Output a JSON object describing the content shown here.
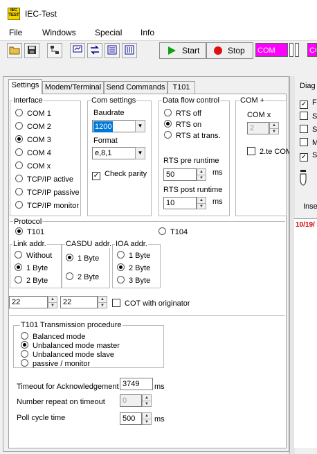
{
  "window": {
    "title": "IEC-Test",
    "app_icon_text": "IEC TEST"
  },
  "menu": [
    "File",
    "Windows",
    "Special",
    "Info"
  ],
  "toolbar": {
    "start_label": "Start",
    "stop_label": "Stop",
    "com_indicator_1": "COM",
    "com_indicator_2": "CO",
    "icons": [
      "open-icon",
      "save-icon",
      "connect-icon",
      "monitor-icon",
      "swap-icon",
      "list-icon",
      "settings-icon"
    ]
  },
  "tabs": [
    "Settings",
    "Modem/Terminal",
    "Send Commands",
    "T101"
  ],
  "interface": {
    "title": "Interface",
    "options": [
      "COM 1",
      "COM 2",
      "COM 3",
      "COM 4",
      "COM x",
      "TCP/IP active",
      "TCP/IP passive",
      "TCP/IP monitor"
    ],
    "selected": "COM 3"
  },
  "com_settings": {
    "title": "Com settings",
    "baudrate_label": "Baudrate",
    "baudrate_value": "1200",
    "format_label": "Format",
    "format_value": "e,8,1",
    "check_parity_label": "Check parity",
    "check_parity": true
  },
  "data_flow": {
    "title": "Data flow control",
    "options": [
      "RTS off",
      "RTS on",
      "RTS at trans."
    ],
    "selected": "RTS on",
    "pre_label": "RTS pre runtime",
    "pre_value": "50",
    "post_label": "RTS post runtime",
    "post_value": "10",
    "unit": "ms"
  },
  "com_plus": {
    "title": "COM +",
    "comx_label": "COM x",
    "comx_value": "2",
    "second_com_label": "2.te COM"
  },
  "protocol": {
    "title": "Protocol",
    "options": [
      "T101",
      "T104"
    ],
    "selected": "T101"
  },
  "link_addr": {
    "title": "Link addr.",
    "options": [
      "Without",
      "1 Byte",
      "2 Byte"
    ],
    "selected": "1 Byte"
  },
  "casdu_addr": {
    "title": "CASDU addr.",
    "options": [
      "1 Byte",
      "2 Byte"
    ],
    "selected": "1 Byte"
  },
  "ioa_addr": {
    "title": "IOA addr.",
    "options": [
      "1 Byte",
      "2 Byte",
      "3 Byte"
    ],
    "selected": "2 Byte"
  },
  "address_values": {
    "first": "22",
    "second": "22",
    "cot_label": "COT with originator"
  },
  "transmission": {
    "title": "T101 Transmission procedure",
    "options": [
      "Balanced mode",
      "Unbalanced mode master",
      "Unbalanced mode slave",
      "passive / monitor"
    ],
    "selected": "Unbalanced mode master"
  },
  "timing": {
    "timeout_label": "Timeout for Acknowledgement",
    "timeout_value": "3749",
    "repeat_label": "Number repeat on timeout",
    "repeat_value": "0",
    "poll_label": "Poll cycle time",
    "poll_value": "500",
    "unit": "ms"
  },
  "diag": {
    "title": "Diag",
    "checks": [
      {
        "label": "F",
        "checked": true
      },
      {
        "label": "S",
        "checked": false
      },
      {
        "label": "S",
        "checked": false
      },
      {
        "label": "M",
        "checked": false
      },
      {
        "label": "S",
        "checked": true
      }
    ],
    "insert_label": "Inse",
    "log_first_line": "10/19/",
    "log_color": "#cc0000"
  }
}
